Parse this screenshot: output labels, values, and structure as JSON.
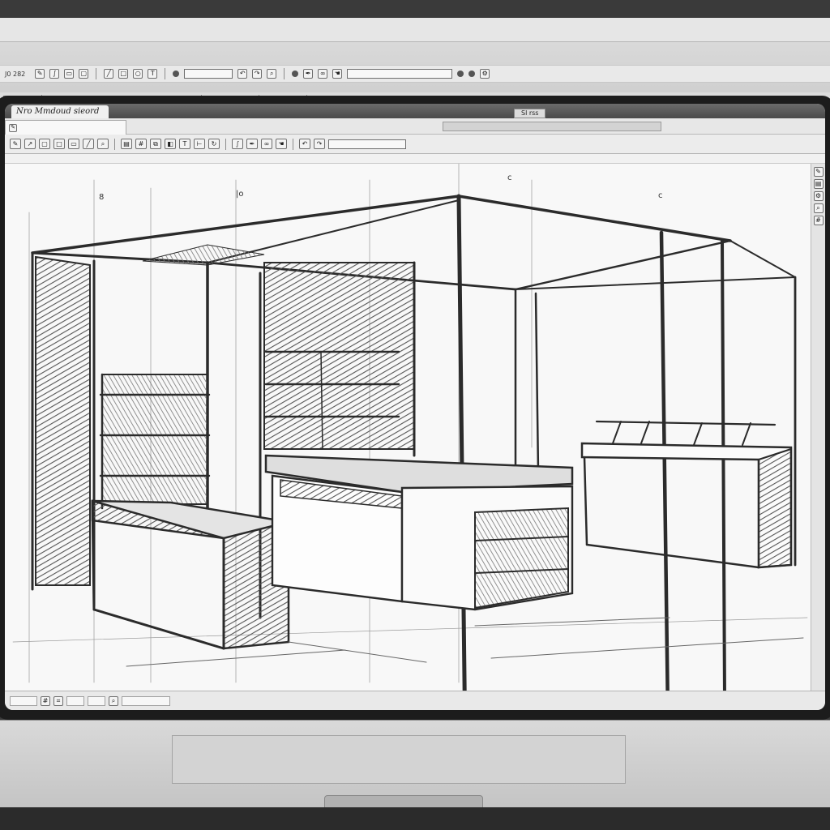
{
  "outer_app": {
    "version_label": "J0 282"
  },
  "inner_app": {
    "title": "Nro Mmdoud sieord",
    "title_center": "Sl rss"
  },
  "icons": {
    "toolbar": [
      "pencil-icon",
      "eraser-icon",
      "select-icon",
      "rect-icon",
      "line-icon",
      "zoom-icon",
      "layers-icon",
      "grid-icon"
    ],
    "window": [
      "close-icon",
      "minimize-icon",
      "maximize-icon"
    ]
  },
  "colors": {
    "bezel": "#1c1c1c",
    "canvas": "#f8f8f8",
    "chrome": "#dedede",
    "ink": "#2b2b2b"
  }
}
